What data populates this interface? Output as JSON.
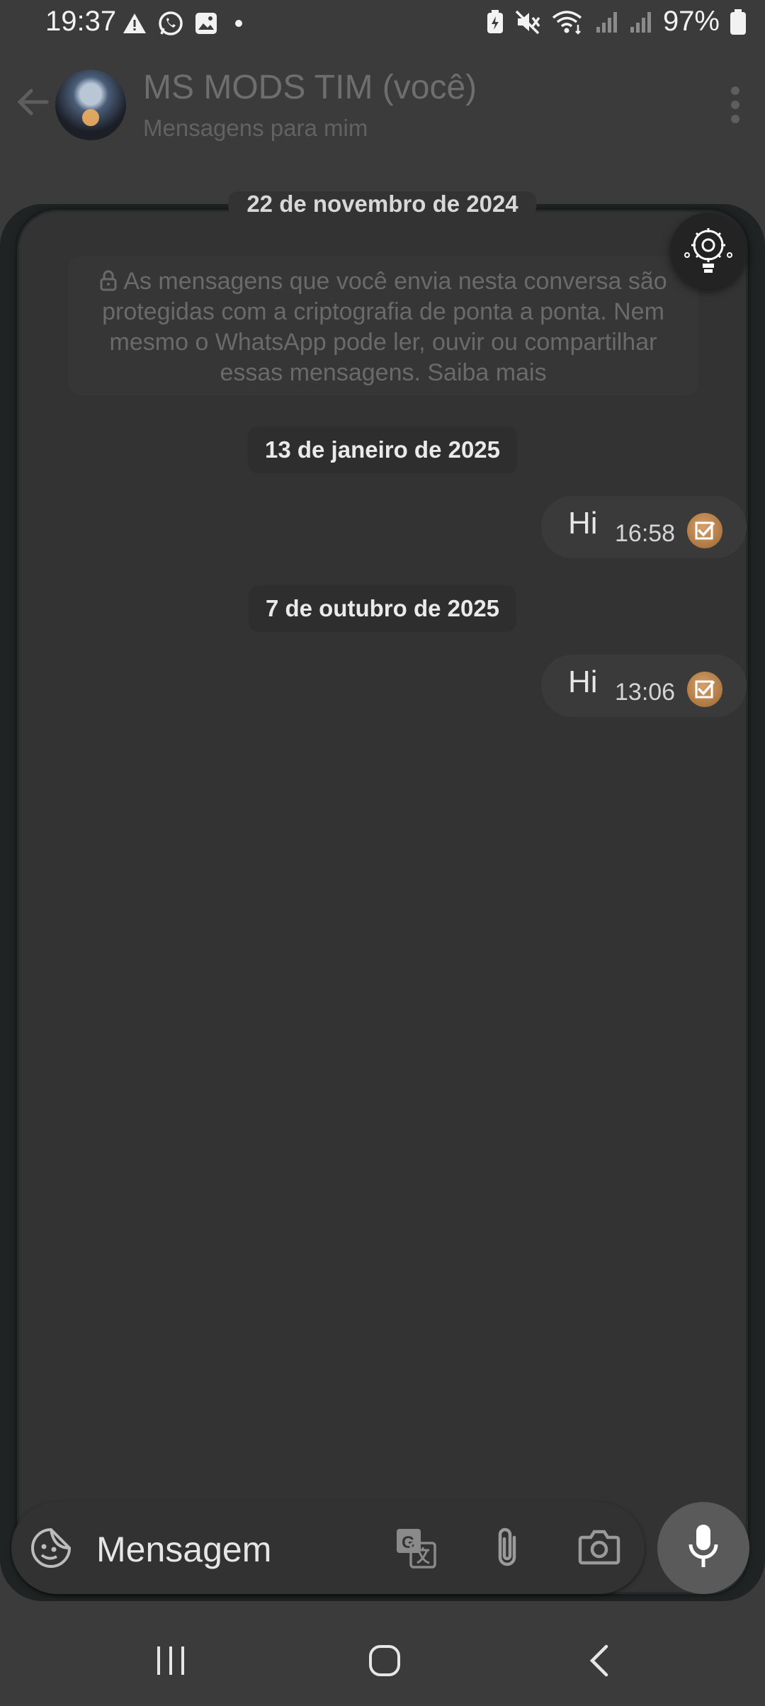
{
  "status_bar": {
    "time": "19:37",
    "battery_text": "97%",
    "left_icons": [
      "alert-icon",
      "whatsapp-icon",
      "gallery-icon",
      "dot-icon"
    ],
    "right_icons": [
      "battery-saver-icon",
      "mute-icon",
      "wifi-icon",
      "signal-icon",
      "signal-icon",
      "battery-icon"
    ]
  },
  "header": {
    "contact_name": "MS MODS TIM (você)",
    "subtitle": "Mensagens para mim"
  },
  "chat": {
    "top_date": "22 de novembro de 2024",
    "encryption_notice": "As mensagens que você envia nesta conversa são protegidas com a criptografia de ponta a ponta. Nem mesmo o WhatsApp pode ler, ouvir ou compartilhar essas mensagens. Saiba mais",
    "groups": [
      {
        "date": "13 de janeiro de 2025",
        "message": {
          "text": "Hi",
          "time": "16:58"
        }
      },
      {
        "date": "7 de outubro de 2025",
        "message": {
          "text": "Hi",
          "time": "13:06"
        }
      }
    ]
  },
  "input": {
    "placeholder": "Mensagem"
  },
  "colors": {
    "background": "#3b3b3b",
    "chat_panel": "#333333",
    "bubble": "#3a3a3a",
    "check_badge": "#c98b4f",
    "mic_button": "#5a5a5a"
  }
}
